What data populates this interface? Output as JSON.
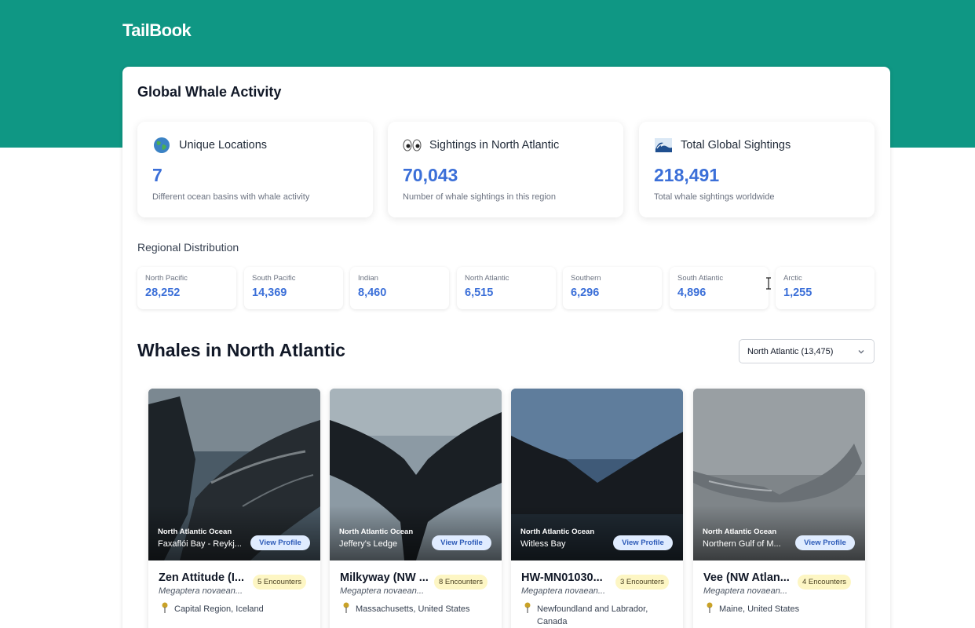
{
  "app": {
    "name": "TailBook"
  },
  "overview": {
    "title": "Global Whale Activity",
    "stats": [
      {
        "icon": "globe-icon",
        "label": "Unique Locations",
        "value": "7",
        "desc": "Different ocean basins with whale activity"
      },
      {
        "icon": "eyes-icon",
        "label": "Sightings in North Atlantic",
        "value": "70,043",
        "desc": "Number of whale sightings in this region"
      },
      {
        "icon": "wave-icon",
        "label": "Total Global Sightings",
        "value": "218,491",
        "desc": "Total whale sightings worldwide"
      }
    ]
  },
  "distribution": {
    "title": "Regional Distribution",
    "regions": [
      {
        "name": "North Pacific",
        "value": "28,252"
      },
      {
        "name": "South Pacific",
        "value": "14,369"
      },
      {
        "name": "Indian",
        "value": "8,460"
      },
      {
        "name": "North Atlantic",
        "value": "6,515"
      },
      {
        "name": "Southern",
        "value": "6,296"
      },
      {
        "name": "South Atlantic",
        "value": "4,896"
      },
      {
        "name": "Arctic",
        "value": "1,255"
      }
    ]
  },
  "whales": {
    "title": "Whales in North Atlantic",
    "select_value": "North Atlantic (13,475)",
    "cards": [
      {
        "ocean": "North Atlantic Ocean",
        "location": "Faxaflói Bay - Reykj...",
        "view_label": "View Profile",
        "name": "Zen Attitude (I...",
        "encounters": "5 Encounters",
        "species": "Megaptera novaean...",
        "place": "Capital Region, Iceland"
      },
      {
        "ocean": "North Atlantic Ocean",
        "location": "Jeffery's Ledge",
        "view_label": "View Profile",
        "name": "Milkyway (NW ...",
        "encounters": "8 Encounters",
        "species": "Megaptera novaean...",
        "place": "Massachusetts, United States"
      },
      {
        "ocean": "North Atlantic Ocean",
        "location": "Witless Bay",
        "view_label": "View Profile",
        "name": "HW-MN01030...",
        "encounters": "3 Encounters",
        "species": "Megaptera novaean...",
        "place": "Newfoundland and Labrador, Canada"
      },
      {
        "ocean": "North Atlantic Ocean",
        "location": "Northern Gulf of M...",
        "view_label": "View Profile",
        "name": "Vee (NW Atlan...",
        "encounters": "4 Encounters",
        "species": "Megaptera novaean...",
        "place": "Maine, United States"
      }
    ]
  }
}
